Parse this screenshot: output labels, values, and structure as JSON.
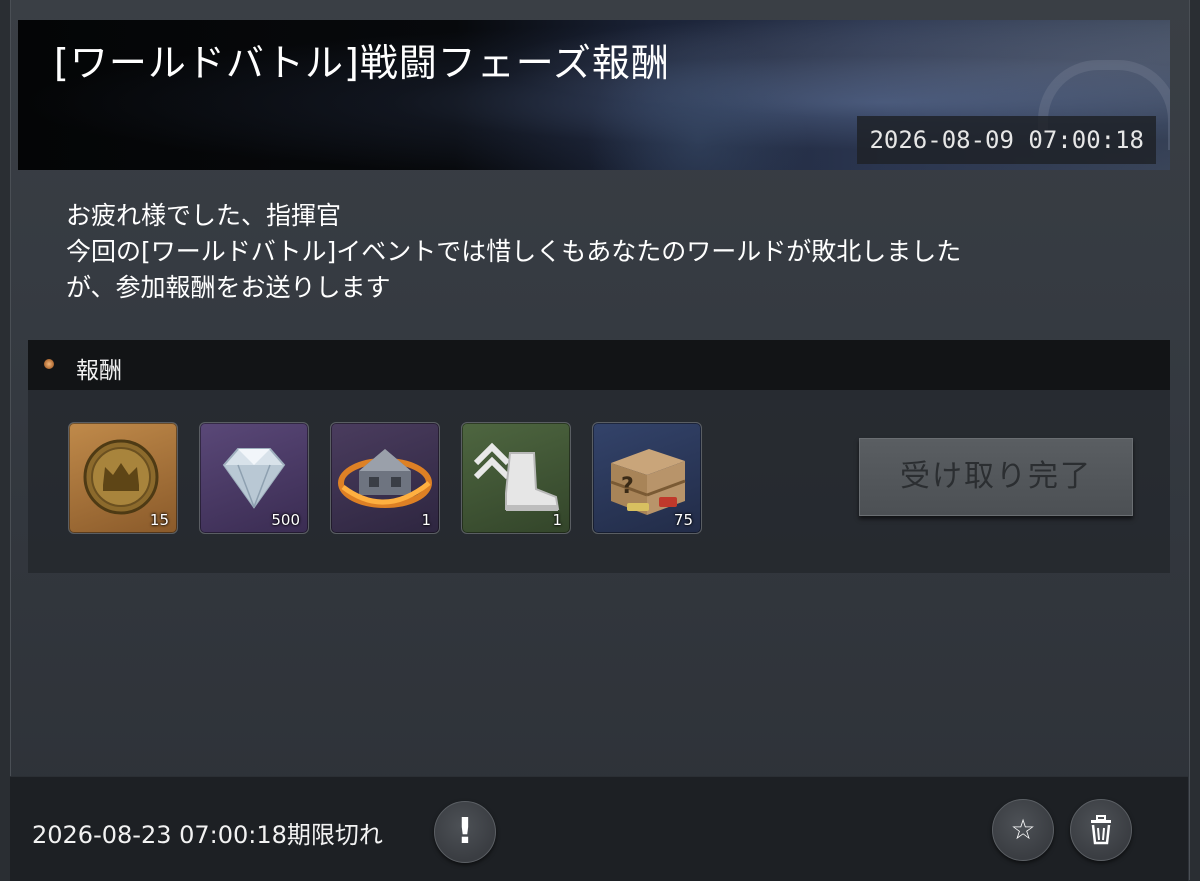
{
  "mail": {
    "title": "[ワールドバトル]戦闘フェーズ報酬",
    "sent_date": "2026-08-09 07:00:18",
    "message_lines": [
      "お疲れ様でした、指揮官",
      "今回の[ワールドバトル]イベントでは惜しくもあなたのワールドが敗北しました",
      "が、参加報酬をお送りします"
    ]
  },
  "rewards": {
    "header": "報酬",
    "items": [
      {
        "icon": "crown-coin-icon",
        "count": "15"
      },
      {
        "icon": "diamond-icon",
        "count": "500"
      },
      {
        "icon": "building-teleport-icon",
        "count": "1"
      },
      {
        "icon": "rank-boot-icon",
        "count": "1"
      },
      {
        "icon": "mystery-crate-icon",
        "count": "75"
      }
    ],
    "claim_label": "受け取り完了"
  },
  "footer": {
    "expiry_text": "2026-08-23 07:00:18期限切れ",
    "warning_glyph": "!",
    "favorite_glyph": "☆"
  },
  "colors": {
    "item_backgrounds": [
      "#a0703a",
      "#4a3a5e",
      "#3a2f4a",
      "#3d5230",
      "#2d3a5a"
    ]
  }
}
